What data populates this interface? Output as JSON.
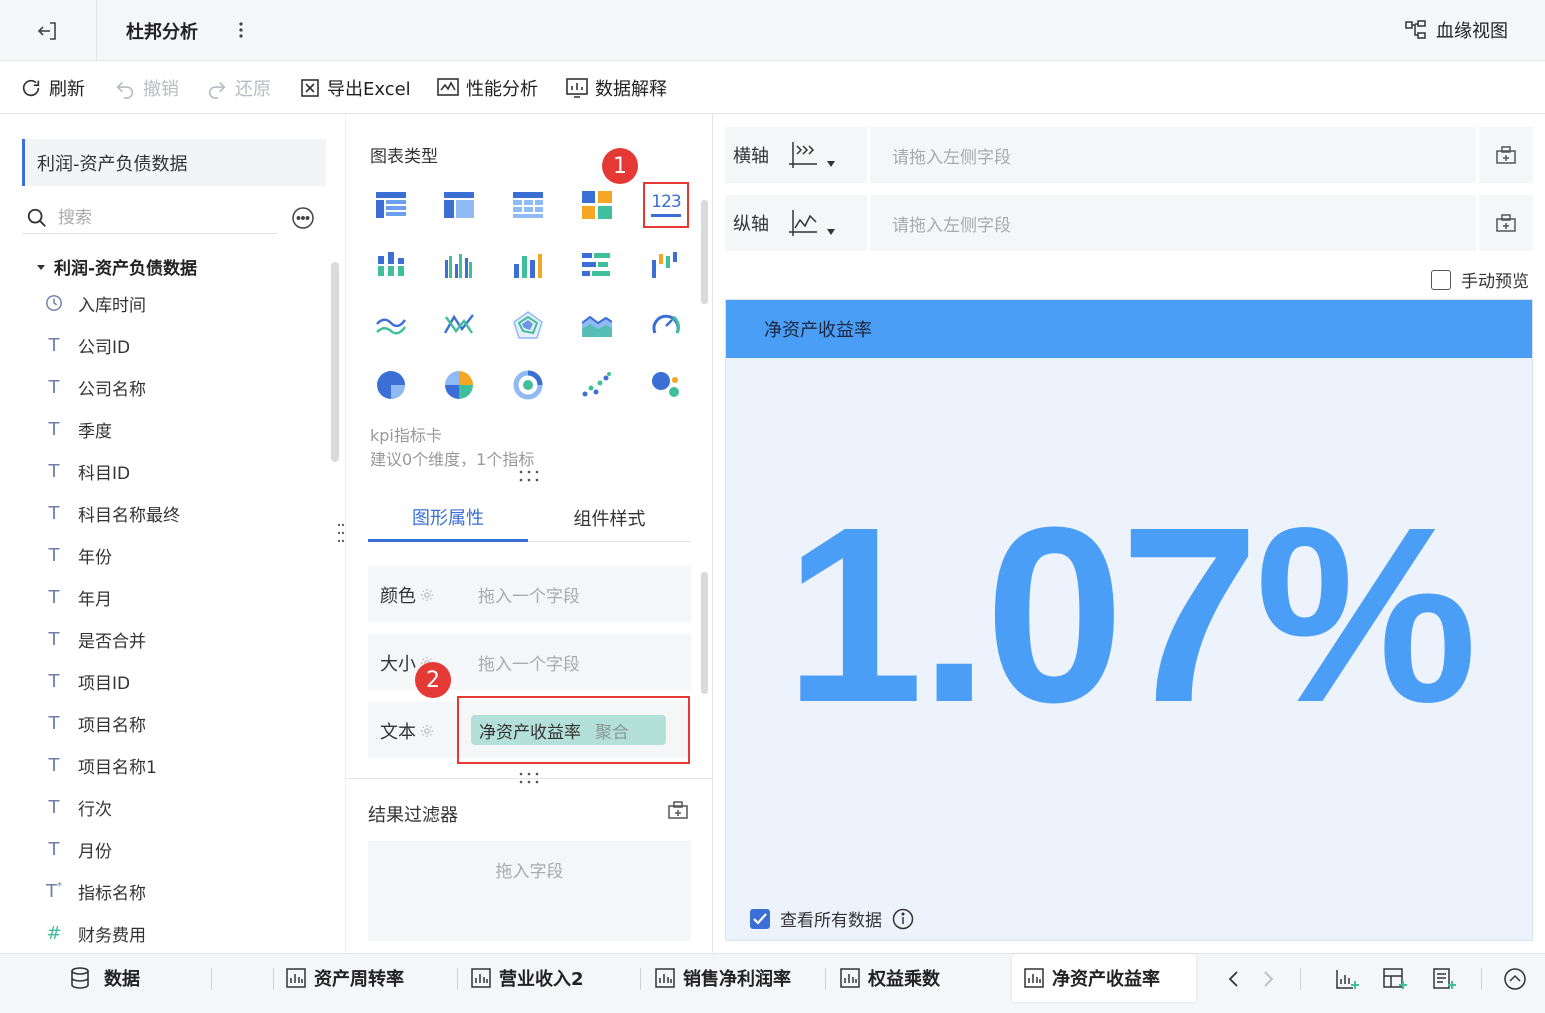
{
  "header": {
    "title": "杜邦分析",
    "lineage_label": "血缘视图"
  },
  "toolbar": {
    "refresh": "刷新",
    "undo": "撤销",
    "redo": "还原",
    "export": "导出Excel",
    "performance": "性能分析",
    "explain": "数据解释"
  },
  "left": {
    "dataset": "利润-资产负债数据",
    "search_placeholder": "搜索",
    "tree_root": "利润-资产负债数据",
    "fields": [
      {
        "label": "入库时间",
        "icon": "clock-icon"
      },
      {
        "label": "公司ID",
        "icon": "text-type-icon"
      },
      {
        "label": "公司名称",
        "icon": "text-type-icon"
      },
      {
        "label": "季度",
        "icon": "text-type-icon"
      },
      {
        "label": "科目ID",
        "icon": "text-type-icon"
      },
      {
        "label": "科目名称最终",
        "icon": "text-type-icon"
      },
      {
        "label": "年份",
        "icon": "text-type-icon"
      },
      {
        "label": "年月",
        "icon": "text-type-icon"
      },
      {
        "label": "是否合并",
        "icon": "text-type-icon"
      },
      {
        "label": "项目ID",
        "icon": "text-type-icon"
      },
      {
        "label": "项目名称",
        "icon": "text-type-icon"
      },
      {
        "label": "项目名称1",
        "icon": "text-type-icon"
      },
      {
        "label": "行次",
        "icon": "text-type-icon"
      },
      {
        "label": "月份",
        "icon": "text-type-icon"
      },
      {
        "label": "指标名称",
        "icon": "calc-text-type-icon"
      },
      {
        "label": "财务费用",
        "icon": "number-type-icon"
      }
    ]
  },
  "middle": {
    "chart_type_label": "图表类型",
    "selected_chart_text": "123",
    "badge1": "1",
    "badge2": "2",
    "chart_desc_name": "kpi指标卡",
    "chart_desc_hint": "建议0个维度，1个指标",
    "tab_graph": "图形属性",
    "tab_style": "组件样式",
    "color_label": "颜色",
    "color_drop": "拖入一个字段",
    "size_label": "大小",
    "size_drop": "拖入一个字段",
    "text_label": "文本",
    "text_field": "净资产收益率",
    "text_agg": "聚合",
    "filter_label": "结果过滤器",
    "filter_drop": "拖入字段"
  },
  "right": {
    "x_axis_label": "横轴",
    "x_axis_placeholder": "请拖入左侧字段",
    "y_axis_label": "纵轴",
    "y_axis_placeholder": "请拖入左侧字段",
    "manual_preview": "手动预览",
    "kpi_title": "净资产收益率",
    "kpi_value": "1.07%",
    "view_all": "查看所有数据"
  },
  "bottom_tabs": {
    "data": "数据",
    "t1": "资产周转率",
    "t2": "营业收入2",
    "t3": "销售净利润率",
    "t4": "权益乘数",
    "t5": "净资产收益率"
  },
  "colors": {
    "accent": "#3b6fd6",
    "kpi_blue": "#4a9ef6",
    "highlight_red": "#e53935",
    "pill_teal": "#b3e0d8"
  }
}
